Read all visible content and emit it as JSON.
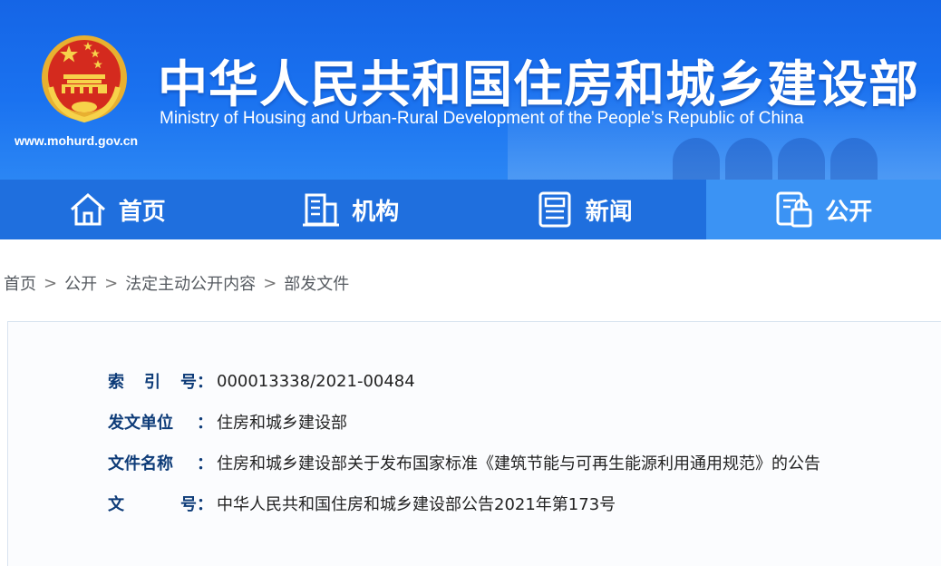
{
  "header": {
    "title_cn": "中华人民共和国住房和城乡建设部",
    "title_en": "Ministry of Housing and Urban-Rural Development of the People’s Republic of China",
    "site_url": "www.mohurd.gov.cn",
    "colors": {
      "banner": "#1a72f0",
      "nav": "#1f6fde",
      "nav_active": "#3b93f4"
    }
  },
  "nav": {
    "items": [
      {
        "label": "首页",
        "icon": "home-icon"
      },
      {
        "label": "机构",
        "icon": "building-icon"
      },
      {
        "label": "新闻",
        "icon": "news-icon"
      },
      {
        "label": "公开",
        "icon": "disclosure-icon",
        "active": true
      }
    ]
  },
  "breadcrumb": {
    "items": [
      "首页",
      "公开",
      "法定主动公开内容",
      "部发文件"
    ],
    "separator": ">"
  },
  "info": {
    "rows": [
      {
        "key": [
          "索",
          "引",
          "号"
        ],
        "value": "000013338/2021-00484"
      },
      {
        "key": [
          "发文单位"
        ],
        "value": "住房和城乡建设部"
      },
      {
        "key": [
          "文件名称"
        ],
        "value": "住房和城乡建设部关于发布国家标准《建筑节能与可再生能源利用通用规范》的公告"
      },
      {
        "key": [
          "文",
          "号"
        ],
        "value": "中华人民共和国住房和城乡建设部公告2021年第173号"
      }
    ],
    "colon": "："
  }
}
